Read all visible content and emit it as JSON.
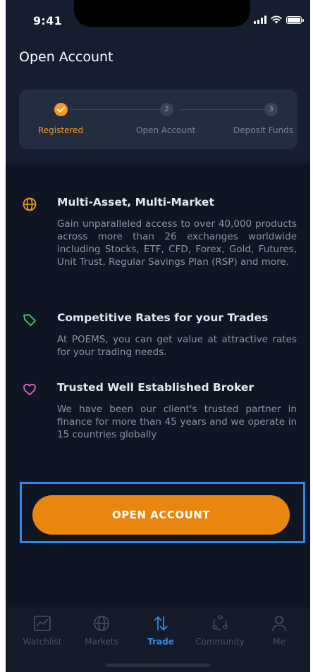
{
  "status_bar": {
    "time": "9:41"
  },
  "page": {
    "title": "Open Account"
  },
  "stepper": {
    "steps": [
      {
        "label": "Registered",
        "number": "",
        "state": "done"
      },
      {
        "label": "Open Account",
        "number": "2",
        "state": "pending"
      },
      {
        "label": "Deposit Funds",
        "number": "3",
        "state": "pending"
      }
    ]
  },
  "features": [
    {
      "icon": "globe-icon",
      "color": "#f39c1f",
      "title": "Multi-Asset, Multi-Market",
      "description": "Gain unparalleled access to over 40,000 products across more than 26 exchanges worldwide including Stocks, ETF, CFD, Forex, Gold, Futures, Unit Trust, Regular Savings Plan (RSP) and more."
    },
    {
      "icon": "tag-icon",
      "color": "#3ecb62",
      "title": "Competitive Rates for your Trades",
      "description": "At POEMS, you can get value at attractive rates for your trading needs."
    },
    {
      "icon": "heart-icon",
      "color": "#e85ec8",
      "title": "Trusted Well Established Broker",
      "description": "We have been our client's trusted partner in finance for more than 45 years and we operate in 15 countries globally"
    }
  ],
  "cta": {
    "label": "OPEN ACCOUNT"
  },
  "tabbar": {
    "tabs": [
      {
        "label": "Watchlist",
        "icon": "chart-icon",
        "active": false
      },
      {
        "label": "Markets",
        "icon": "globe-icon",
        "active": false
      },
      {
        "label": "Trade",
        "icon": "arrows-up-down-icon",
        "active": true
      },
      {
        "label": "Community",
        "icon": "community-icon",
        "active": false
      },
      {
        "label": "Me",
        "icon": "person-icon",
        "active": false
      }
    ]
  },
  "colors": {
    "accent": "#f39c1f",
    "active_tab": "#2b8be6",
    "background": "#0f1523"
  }
}
